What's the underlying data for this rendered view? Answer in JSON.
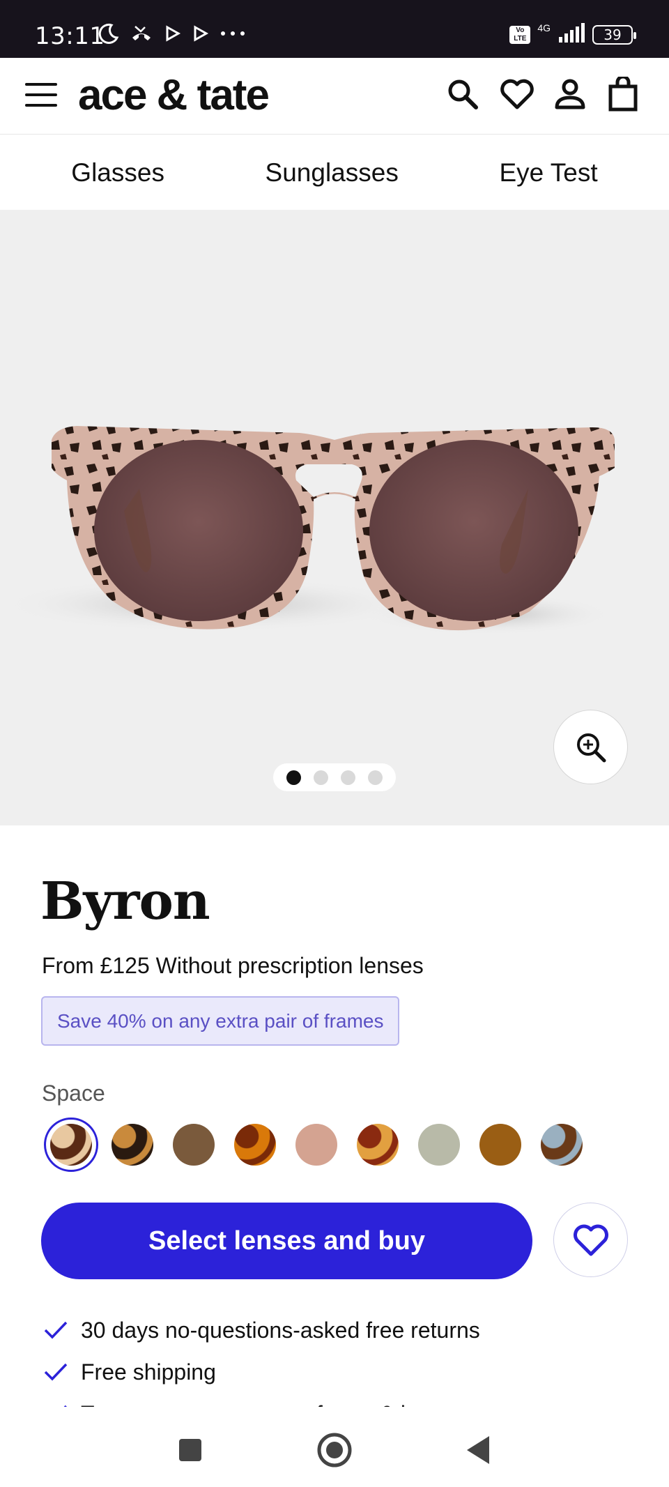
{
  "status_bar": {
    "time": "13:11",
    "battery": "39",
    "network": "4G",
    "volte": "Vo LTE",
    "icons": [
      "moon-icon",
      "missed-call-icon",
      "play-icon",
      "play-icon",
      "more-dots-icon"
    ]
  },
  "header": {
    "logo": "ace & tate",
    "icons": [
      "menu-icon",
      "search-icon",
      "heart-icon",
      "account-icon",
      "bag-icon"
    ]
  },
  "nav": {
    "items": [
      "Glasses",
      "Sunglasses",
      "Eye Test"
    ]
  },
  "gallery": {
    "page_count": 4,
    "active_index": 0
  },
  "product": {
    "name": "Byron",
    "price_prefix": "From ",
    "price": "£125",
    "price_suffix": " Without prescription lenses",
    "promo": "Save 40% on any extra pair of frames",
    "color_label": "Space",
    "swatches": [
      {
        "name": "space",
        "colors": [
          "#5a2a14",
          "#e8c8a0"
        ],
        "selected": true
      },
      {
        "name": "tortoise",
        "colors": [
          "#2a1a10",
          "#c98a3c"
        ],
        "selected": false
      },
      {
        "name": "brown",
        "colors": [
          "#7a5a3c"
        ],
        "selected": false
      },
      {
        "name": "amber",
        "colors": [
          "#d9790a",
          "#7a2a08"
        ],
        "selected": false
      },
      {
        "name": "rose",
        "colors": [
          "#d4a391"
        ],
        "selected": false
      },
      {
        "name": "honey",
        "colors": [
          "#e2a040",
          "#8a2a10"
        ],
        "selected": false
      },
      {
        "name": "sage",
        "colors": [
          "#b8baa8"
        ],
        "selected": false
      },
      {
        "name": "caramel",
        "colors": [
          "#9a5e14"
        ],
        "selected": false
      },
      {
        "name": "havana-blue",
        "colors": [
          "#6a3a18",
          "#9ab0c0"
        ],
        "selected": false
      }
    ],
    "buy_label": "Select lenses and buy"
  },
  "usps": [
    "30 days no-questions-asked free returns",
    "Free shipping",
    "Two-year guarantee on frame & lenses"
  ],
  "colors": {
    "accent": "#2c22d9",
    "promo_bg": "#eae9fb",
    "promo_text": "#5a50c4",
    "status_bar": "#17131c"
  }
}
